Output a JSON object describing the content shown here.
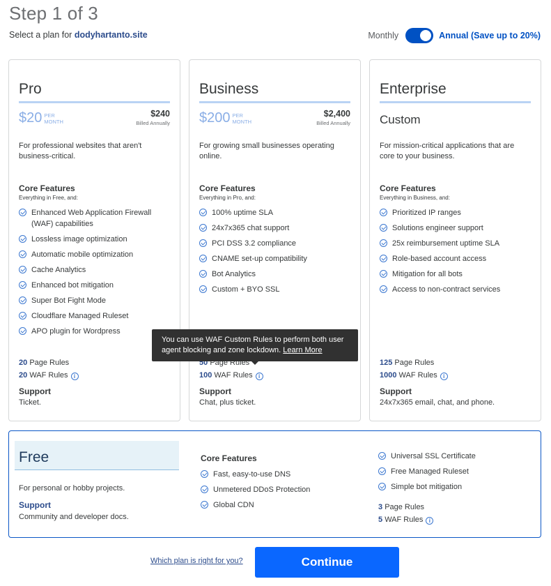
{
  "header": {
    "step_title": "Step 1 of 3",
    "select_prefix": "Select a plan for",
    "domain": "dodyhartanto.site"
  },
  "billing": {
    "monthly_label": "Monthly",
    "annual_label": "Annual (Save up to 20%)",
    "annual_selected": true
  },
  "plans": [
    {
      "name": "Pro",
      "price": "$20",
      "per_line1": "PER",
      "per_line2": "MONTH",
      "annual_total": "$240",
      "billed": "Billed Annually",
      "description": "For professional websites that aren't business-critical.",
      "core_title": "Core Features",
      "core_sub": "Everything in Free, and:",
      "features": [
        "Enhanced Web Application Firewall (WAF) capabilities",
        "Lossless image optimization",
        "Automatic mobile optimization",
        "Cache Analytics",
        "Enhanced bot mitigation",
        "Super Bot Fight Mode",
        "Cloudflare Managed Ruleset",
        "APO plugin for Wordpress"
      ],
      "page_rules_num": "20",
      "page_rules_label": "Page Rules",
      "waf_rules_num": "20",
      "waf_rules_label": "WAF Rules",
      "support_title": "Support",
      "support_desc": "Ticket."
    },
    {
      "name": "Business",
      "price": "$200",
      "per_line1": "PER",
      "per_line2": "MONTH",
      "annual_total": "$2,400",
      "billed": "Billed Annually",
      "description": "For growing small businesses operating online.",
      "core_title": "Core Features",
      "core_sub": "Everything in Pro, and:",
      "features": [
        "100% uptime SLA",
        "24x7x365 chat support",
        "PCI DSS 3.2 compliance",
        "CNAME set-up compatibility",
        "Bot Analytics",
        "Custom + BYO SSL"
      ],
      "page_rules_num": "50",
      "page_rules_label": "Page Rules",
      "waf_rules_num": "100",
      "waf_rules_label": "WAF Rules",
      "support_title": "Support",
      "support_desc": "Chat, plus ticket."
    },
    {
      "name": "Enterprise",
      "custom_price": "Custom",
      "description": "For mission-critical applications that are core to your business.",
      "core_title": "Core Features",
      "core_sub": "Everything in Business, and:",
      "features": [
        "Prioritized IP ranges",
        "Solutions engineer support",
        "25x reimbursement uptime SLA",
        "Role-based account access",
        "Mitigation for all bots",
        "Access to non-contract services"
      ],
      "page_rules_num": "125",
      "page_rules_label": "Page Rules",
      "waf_rules_num": "1000",
      "waf_rules_label": "WAF Rules",
      "support_title": "Support",
      "support_desc": "24x7x365 email, chat, and phone."
    }
  ],
  "tooltip": {
    "text": "You can use WAF Custom Rules to perform both user agent blocking and zone lockdown.",
    "link": "Learn More"
  },
  "free": {
    "name": "Free",
    "description": "For personal or hobby projects.",
    "support_title": "Support",
    "support_desc": "Community and developer docs.",
    "core_title": "Core Features",
    "features_col1": [
      "Fast, easy-to-use DNS",
      "Unmetered DDoS Protection",
      "Global CDN"
    ],
    "features_col2": [
      "Universal SSL Certificate",
      "Free Managed Ruleset",
      "Simple bot mitigation"
    ],
    "page_rules_num": "3",
    "page_rules_label": "Page Rules",
    "waf_rules_num": "5",
    "waf_rules_label": "WAF Rules"
  },
  "footer": {
    "which_plan_link": "Which plan is right for you?",
    "continue_label": "Continue"
  },
  "colors": {
    "accent": "#0051c3",
    "continue_button": "#0a67ff",
    "price_light_blue": "#8aaee6"
  }
}
